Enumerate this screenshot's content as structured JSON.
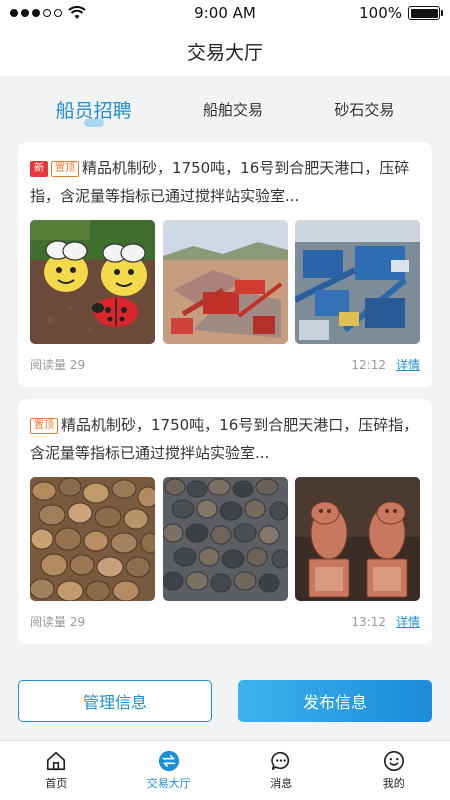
{
  "status_bar": {
    "time": "9:00 AM",
    "battery": "100%"
  },
  "header": {
    "title": "交易大厅"
  },
  "tabs": [
    {
      "label": "船员招聘",
      "active": true
    },
    {
      "label": "船舶交易",
      "active": false
    },
    {
      "label": "砂石交易",
      "active": false
    }
  ],
  "posts": [
    {
      "tags": [
        "新",
        "置顶"
      ],
      "title": "精品机制砂，1750吨，16号到合肥天港口，压碎指，含泥量等指标已通过搅拌站实验室...",
      "views": "阅读量 29",
      "time": "12:12",
      "detail_label": "详情",
      "images": [
        "painted-rocks-photo",
        "sand-crusher-plant-photo",
        "stone-crushing-machinery-photo"
      ]
    },
    {
      "tags": [
        "置顶"
      ],
      "title": "精品机制砂，1750吨，16号到合肥天港口，压碎指，含泥量等指标已通过搅拌站实验室...",
      "views": "阅读量 29",
      "time": "13:12",
      "detail_label": "详情",
      "images": [
        "pebbles-photo",
        "dark-pebbles-photo",
        "carved-stone-lions-photo"
      ]
    }
  ],
  "actions": {
    "manage_label": "管理信息",
    "publish_label": "发布信息"
  },
  "tabbar": [
    {
      "label": "首页",
      "icon": "home-icon",
      "active": false
    },
    {
      "label": "交易大厅",
      "icon": "exchange-icon",
      "active": true
    },
    {
      "label": "消息",
      "icon": "message-icon",
      "active": false
    },
    {
      "label": "我的",
      "icon": "profile-icon",
      "active": false
    }
  ],
  "colors": {
    "accent": "#1d8fd6",
    "tag_new": "#e8383d",
    "tag_top": "#ee7a2c"
  }
}
